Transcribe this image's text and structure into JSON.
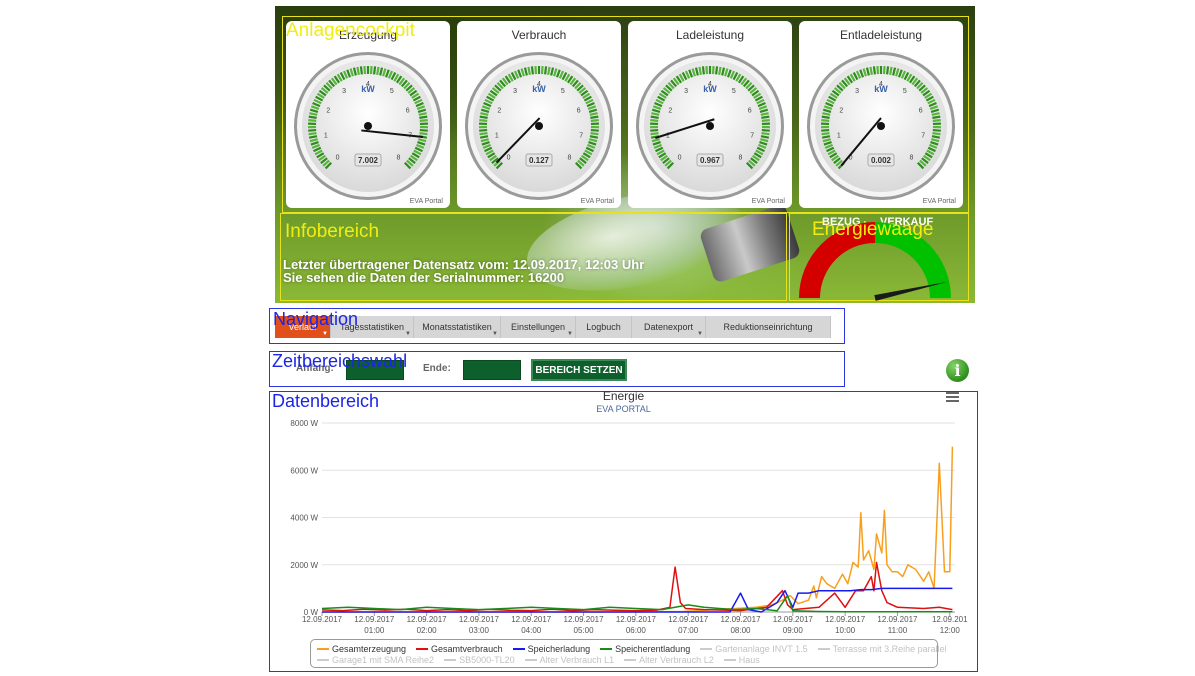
{
  "cockpit": {
    "label": "Anlagencockpit",
    "gauges": [
      {
        "title": "Erzeugung",
        "unit": "kW",
        "value": 7.002,
        "display": "7.002",
        "credit": "EVA Portal"
      },
      {
        "title": "Verbrauch",
        "unit": "kW",
        "value": 0.127,
        "display": "0.127",
        "credit": "EVA Portal"
      },
      {
        "title": "Ladeleistung",
        "unit": "kW",
        "value": 0.967,
        "display": "0.967",
        "credit": "EVA Portal"
      },
      {
        "title": "Entladeleistung",
        "unit": "kW",
        "value": 0.002,
        "display": "0.002",
        "credit": "EVA Portal"
      }
    ],
    "gauge_ticks": [
      "0",
      "1",
      "2",
      "3",
      "4",
      "5",
      "6",
      "7",
      "8"
    ],
    "gauge_max": 8
  },
  "info": {
    "label": "Infobereich",
    "line1": "Letzter übertragener Datensatz vom: 12.09.2017, 12:03 Uhr",
    "line2": "Sie sehen die Daten der Serialnummer: 16200"
  },
  "balance": {
    "label": "Energiewaage",
    "left_label": "BEZUG",
    "right_label": "VERKAUF",
    "left_color": "#d40000",
    "right_color": "#00c000",
    "needle_level": 0.93
  },
  "navigation": {
    "label": "Navigation",
    "items": [
      {
        "label": "Verlauf",
        "active": true,
        "caret": true
      },
      {
        "label": "Tagesstatistiken",
        "active": false,
        "caret": true
      },
      {
        "label": "Monatsstatistiken",
        "active": false,
        "caret": true
      },
      {
        "label": "Einstellungen",
        "active": false,
        "caret": true
      },
      {
        "label": "Logbuch",
        "active": false,
        "caret": false
      },
      {
        "label": "Datenexport",
        "active": false,
        "caret": true
      },
      {
        "label": "Reduktionseinrichtung",
        "active": false,
        "caret": false
      }
    ]
  },
  "range": {
    "label": "Zeitbereichswahl",
    "start_label": "Anfang:",
    "end_label": "Ende:",
    "button": "BEREICH SETZEN",
    "info_icon": "info-icon"
  },
  "data_area": {
    "label": "Datenbereich",
    "menu_icon": "menu-icon"
  },
  "chart_data": {
    "type": "line",
    "title": "Energie",
    "subtitle": "EVA PORTAL",
    "ylim": [
      0,
      8000
    ],
    "y_ticks": [
      "0 W",
      "2000 W",
      "4000 W",
      "6000 W",
      "8000 W"
    ],
    "x_ticks": [
      [
        "12.09.2017",
        ""
      ],
      [
        "12.09.2017",
        "01:00"
      ],
      [
        "12.09.2017",
        "02:00"
      ],
      [
        "12.09.2017",
        "03:00"
      ],
      [
        "12.09.2017",
        "04:00"
      ],
      [
        "12.09.2017",
        "05:00"
      ],
      [
        "12.09.2017",
        "06:00"
      ],
      [
        "12.09.2017",
        "07:00"
      ],
      [
        "12.09.2017",
        "08:00"
      ],
      [
        "12.09.2017",
        "09:00"
      ],
      [
        "12.09.2017",
        "10:00"
      ],
      [
        "12.09.2017",
        "11:00"
      ],
      [
        "12.09.201",
        "12:00"
      ]
    ],
    "x_range_hours": [
      0,
      12.1
    ],
    "series": [
      {
        "name": "Gesamterzeugung",
        "color": "#f7a01e",
        "visible": true,
        "points": [
          [
            0,
            0
          ],
          [
            6.0,
            0
          ],
          [
            6.9,
            20
          ],
          [
            7.2,
            60
          ],
          [
            7.6,
            120
          ],
          [
            7.9,
            150
          ],
          [
            8.3,
            200
          ],
          [
            8.6,
            300
          ],
          [
            8.8,
            500
          ],
          [
            8.95,
            700
          ],
          [
            9.1,
            350
          ],
          [
            9.3,
            500
          ],
          [
            9.4,
            1100
          ],
          [
            9.45,
            600
          ],
          [
            9.55,
            1500
          ],
          [
            9.65,
            1200
          ],
          [
            9.8,
            1000
          ],
          [
            9.95,
            1600
          ],
          [
            10.05,
            1200
          ],
          [
            10.15,
            2100
          ],
          [
            10.25,
            1900
          ],
          [
            10.3,
            4200
          ],
          [
            10.35,
            2200
          ],
          [
            10.45,
            2600
          ],
          [
            10.55,
            1800
          ],
          [
            10.6,
            3300
          ],
          [
            10.7,
            2500
          ],
          [
            10.75,
            4300
          ],
          [
            10.8,
            2000
          ],
          [
            10.9,
            1700
          ],
          [
            11.0,
            1700
          ],
          [
            11.1,
            1500
          ],
          [
            11.2,
            2000
          ],
          [
            11.35,
            1800
          ],
          [
            11.5,
            1300
          ],
          [
            11.6,
            1700
          ],
          [
            11.7,
            1000
          ],
          [
            11.8,
            6300
          ],
          [
            11.9,
            1700
          ],
          [
            12.0,
            1700
          ],
          [
            12.05,
            7000
          ]
        ]
      },
      {
        "name": "Gesamtverbrauch",
        "color": "#e01010",
        "visible": true,
        "points": [
          [
            0,
            90
          ],
          [
            0.4,
            60
          ],
          [
            0.8,
            120
          ],
          [
            1.2,
            80
          ],
          [
            1.6,
            120
          ],
          [
            2.0,
            60
          ],
          [
            2.4,
            100
          ],
          [
            2.8,
            60
          ],
          [
            3.2,
            110
          ],
          [
            3.6,
            70
          ],
          [
            4.0,
            60
          ],
          [
            4.4,
            120
          ],
          [
            4.8,
            60
          ],
          [
            5.2,
            100
          ],
          [
            5.6,
            70
          ],
          [
            6.0,
            60
          ],
          [
            6.4,
            80
          ],
          [
            6.65,
            200
          ],
          [
            6.75,
            1900
          ],
          [
            6.85,
            400
          ],
          [
            6.95,
            150
          ],
          [
            7.3,
            100
          ],
          [
            7.7,
            80
          ],
          [
            8.0,
            60
          ],
          [
            8.5,
            200
          ],
          [
            8.8,
            900
          ],
          [
            8.9,
            300
          ],
          [
            9.0,
            100
          ],
          [
            9.5,
            200
          ],
          [
            9.8,
            800
          ],
          [
            10.0,
            200
          ],
          [
            10.2,
            900
          ],
          [
            10.35,
            900
          ],
          [
            10.5,
            1500
          ],
          [
            10.55,
            900
          ],
          [
            10.6,
            2100
          ],
          [
            10.7,
            900
          ],
          [
            10.8,
            400
          ],
          [
            11.0,
            200
          ],
          [
            11.5,
            150
          ],
          [
            11.8,
            200
          ],
          [
            12.05,
            100
          ]
        ]
      },
      {
        "name": "Speicherladung",
        "color": "#1a1aef",
        "visible": true,
        "points": [
          [
            0,
            0
          ],
          [
            7.8,
            0
          ],
          [
            8.0,
            800
          ],
          [
            8.15,
            100
          ],
          [
            8.4,
            0
          ],
          [
            8.7,
            400
          ],
          [
            8.85,
            900
          ],
          [
            9.0,
            200
          ],
          [
            9.1,
            800
          ],
          [
            9.3,
            800
          ],
          [
            9.5,
            900
          ],
          [
            9.8,
            900
          ],
          [
            10.1,
            900
          ],
          [
            10.3,
            950
          ],
          [
            10.5,
            950
          ],
          [
            10.7,
            1000
          ],
          [
            11.0,
            1000
          ],
          [
            11.5,
            1000
          ],
          [
            12.05,
            1000
          ]
        ]
      },
      {
        "name": "Speicherentladung",
        "color": "#1a8a1a",
        "visible": true,
        "points": [
          [
            0,
            150
          ],
          [
            0.5,
            200
          ],
          [
            1.0,
            150
          ],
          [
            1.5,
            100
          ],
          [
            2.0,
            200
          ],
          [
            2.5,
            150
          ],
          [
            3.0,
            100
          ],
          [
            3.5,
            150
          ],
          [
            4.0,
            200
          ],
          [
            4.5,
            150
          ],
          [
            5.0,
            100
          ],
          [
            5.5,
            200
          ],
          [
            6.0,
            150
          ],
          [
            6.5,
            100
          ],
          [
            7.0,
            300
          ],
          [
            7.3,
            200
          ],
          [
            7.6,
            150
          ],
          [
            7.9,
            100
          ],
          [
            8.3,
            150
          ],
          [
            8.7,
            50
          ],
          [
            8.9,
            700
          ],
          [
            9.0,
            50
          ],
          [
            9.5,
            20
          ],
          [
            10.0,
            10
          ],
          [
            12.05,
            10
          ]
        ]
      },
      {
        "name": "Gartenanlage INVT 1.5",
        "color": "#cccccc",
        "visible": false
      },
      {
        "name": "Terrasse mit 3.Reihe parallel",
        "color": "#cccccc",
        "visible": false
      },
      {
        "name": "Garage1 mit SMA Reihe2",
        "color": "#cccccc",
        "visible": false
      },
      {
        "name": "SB5000-TL20",
        "color": "#cccccc",
        "visible": false
      },
      {
        "name": "Alter Verbrauch L1",
        "color": "#cccccc",
        "visible": false
      },
      {
        "name": "Alter Verbrauch L2",
        "color": "#cccccc",
        "visible": false
      },
      {
        "name": "Haus",
        "color": "#cccccc",
        "visible": false
      }
    ]
  }
}
